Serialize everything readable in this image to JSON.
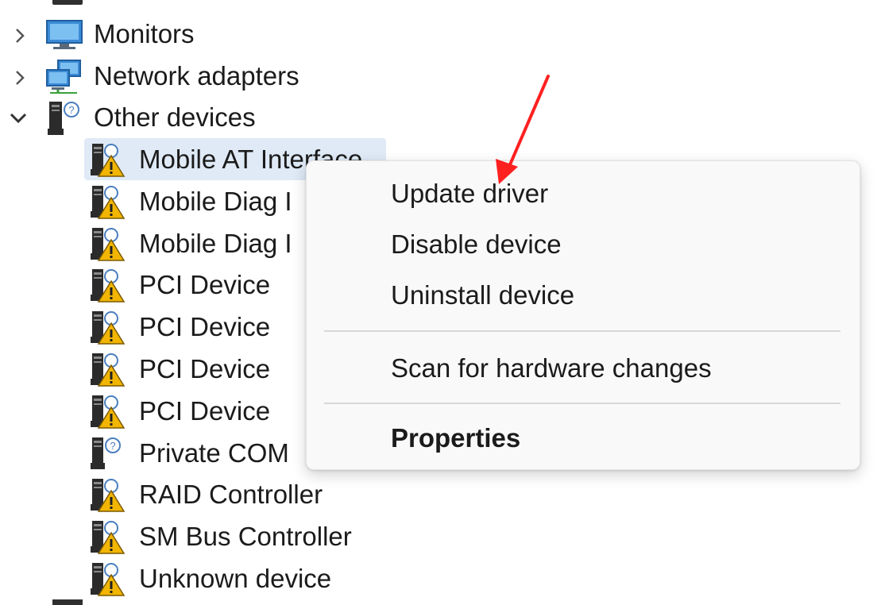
{
  "tree": {
    "categories": [
      {
        "label": "Monitors",
        "expanded": false,
        "icon": "monitor-icon"
      },
      {
        "label": "Network adapters",
        "expanded": false,
        "icon": "network-adapter-icon"
      },
      {
        "label": "Other devices",
        "expanded": true,
        "icon": "unknown-device-icon"
      }
    ],
    "devices": [
      {
        "label": "Mobile AT Interface",
        "selected": true,
        "icon": "warning-device-icon"
      },
      {
        "label": "Mobile Diag I",
        "icon": "warning-device-icon"
      },
      {
        "label": "Mobile Diag I",
        "icon": "warning-device-icon"
      },
      {
        "label": "PCI Device",
        "icon": "warning-device-icon"
      },
      {
        "label": "PCI Device",
        "icon": "warning-device-icon"
      },
      {
        "label": "PCI Device",
        "icon": "warning-device-icon"
      },
      {
        "label": "PCI Device",
        "icon": "warning-device-icon"
      },
      {
        "label": "Private COM",
        "icon": "unknown-device-icon"
      },
      {
        "label": "RAID Controller",
        "icon": "warning-device-icon"
      },
      {
        "label": "SM Bus Controller",
        "icon": "warning-device-icon"
      },
      {
        "label": "Unknown device",
        "icon": "warning-device-icon"
      }
    ]
  },
  "context_menu": {
    "items": [
      {
        "label": "Update driver"
      },
      {
        "label": "Disable device"
      },
      {
        "label": "Uninstall device"
      },
      {
        "label": "Scan for hardware changes"
      },
      {
        "label": "Properties",
        "bold": true
      }
    ]
  },
  "colors": {
    "selection": "#dfeaf6",
    "warning": "#f2b500",
    "annotation_arrow": "#ff2020",
    "menu_bg": "#f9f9f9"
  }
}
